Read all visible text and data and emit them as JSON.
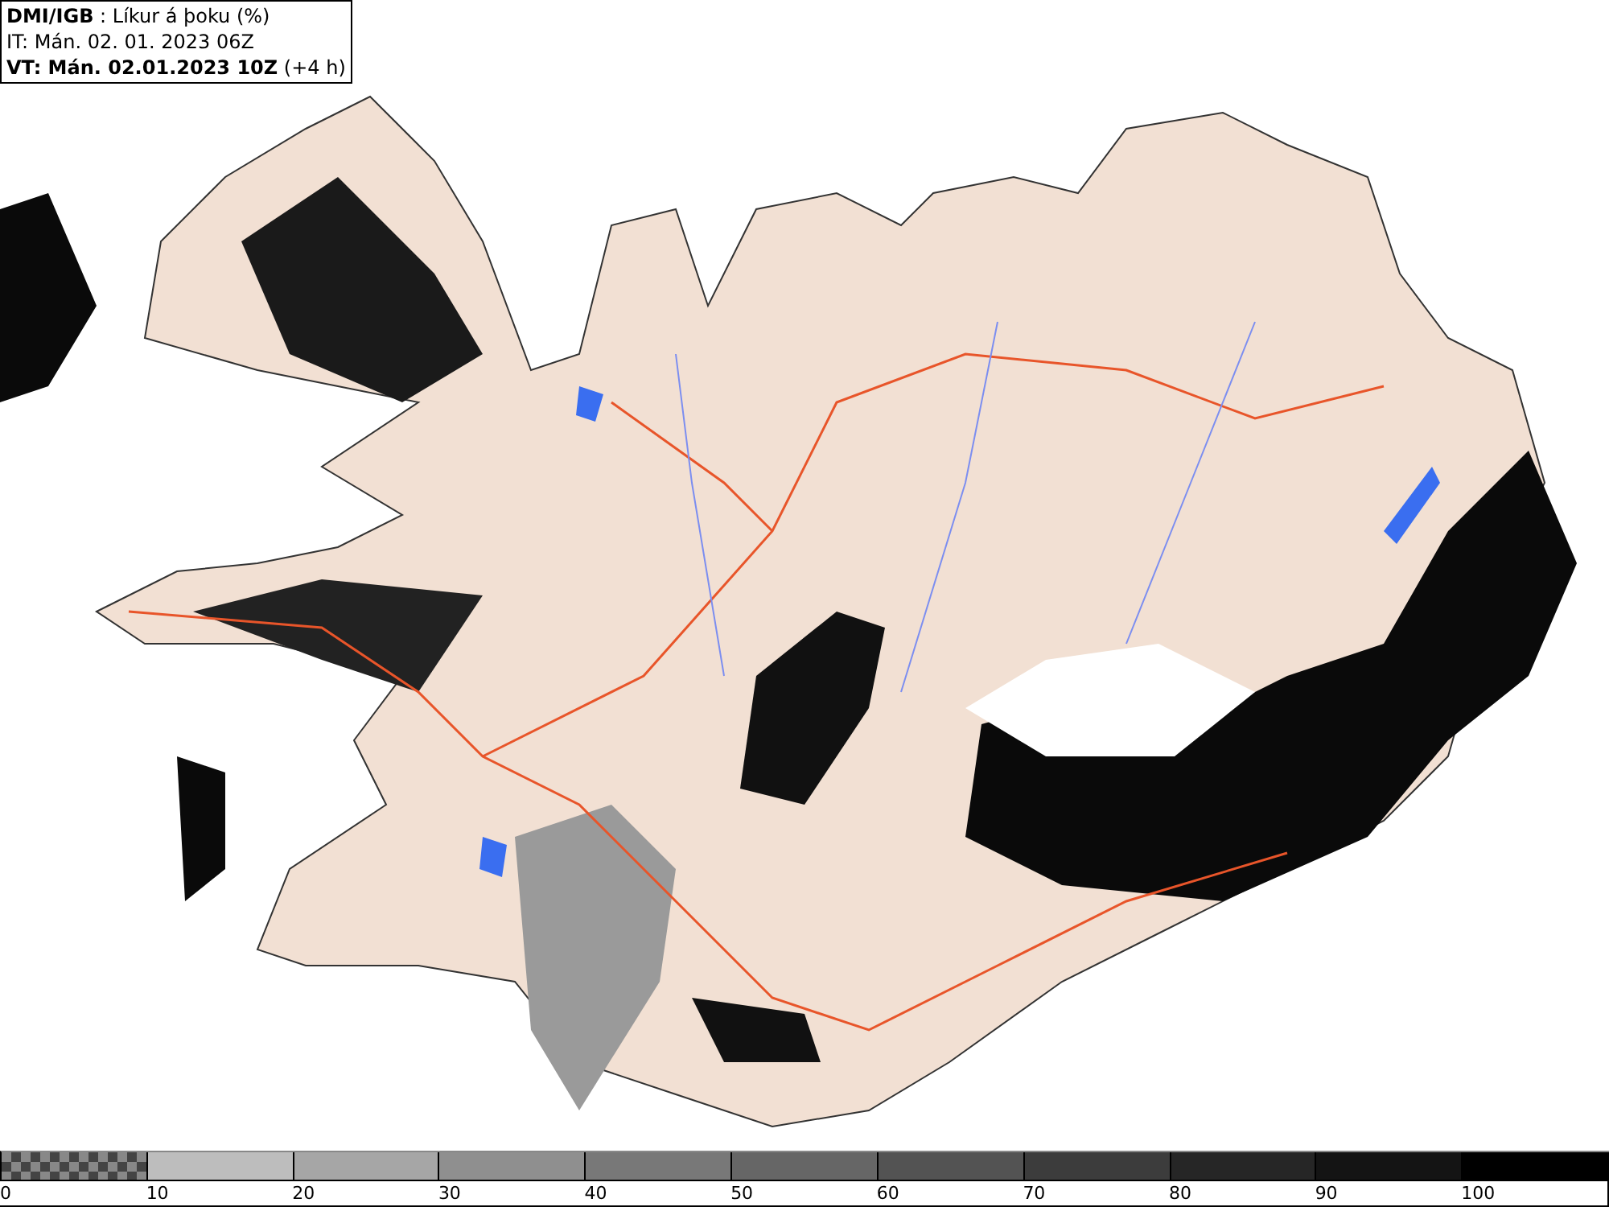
{
  "header": {
    "line_1": "**DMI/IGB** : Líkur á þoku (%)",
    "line_2": "IT: Mán. 02. 01. 2023 06Z",
    "line_3": "**VT: Mán. 02.01.2023 10Z** (+4 h)"
  },
  "legend": {
    "bins": [
      {
        "kind": "checker",
        "color": "#888888"
      },
      {
        "kind": "solid",
        "color": "#bdbdbd"
      },
      {
        "kind": "solid",
        "color": "#a6a6a6"
      },
      {
        "kind": "solid",
        "color": "#8f8f8f"
      },
      {
        "kind": "solid",
        "color": "#787878"
      },
      {
        "kind": "solid",
        "color": "#666666"
      },
      {
        "kind": "solid",
        "color": "#535353"
      },
      {
        "kind": "solid",
        "color": "#3c3c3c"
      },
      {
        "kind": "solid",
        "color": "#262626"
      },
      {
        "kind": "solid",
        "color": "#141414"
      },
      {
        "kind": "solid",
        "color": "#000000"
      }
    ],
    "labels": [
      "0",
      "10",
      "20",
      "30",
      "40",
      "50",
      "60",
      "70",
      "80",
      "90",
      "100"
    ]
  }
}
